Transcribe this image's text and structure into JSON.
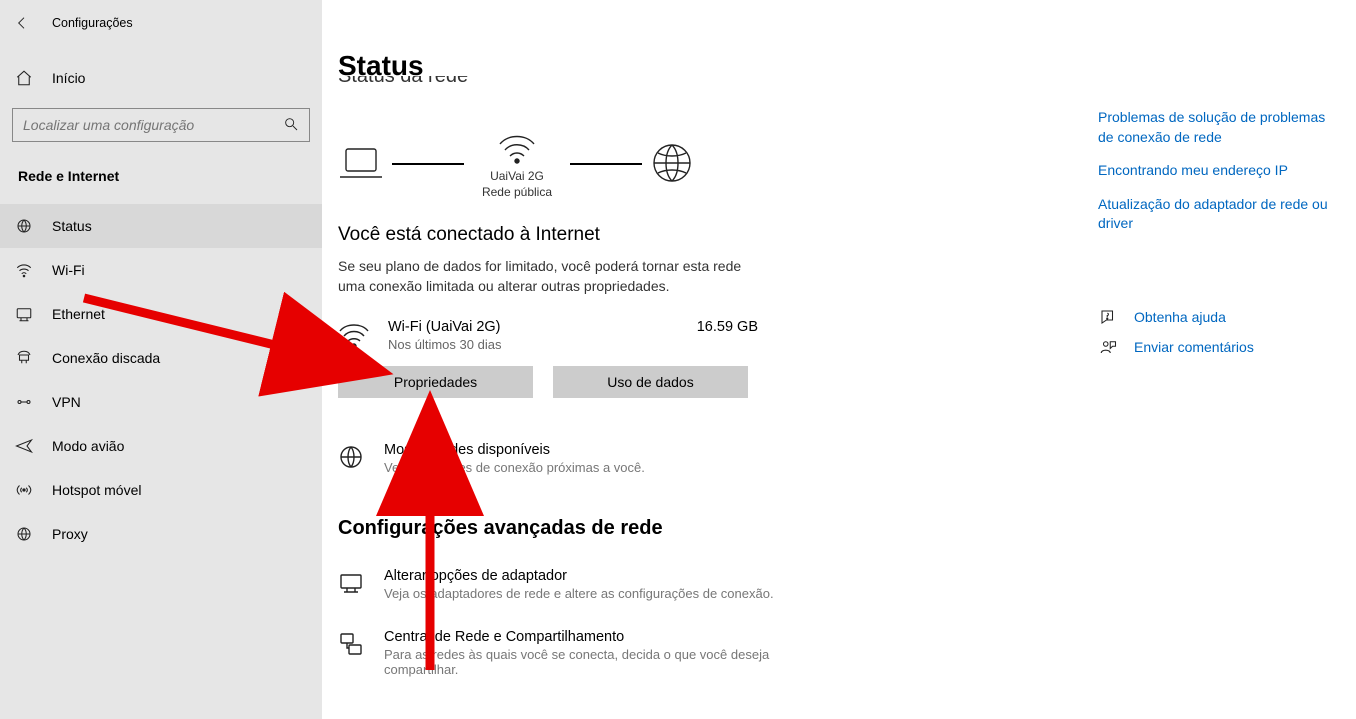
{
  "app_title": "Configurações",
  "home_label": "Início",
  "search_placeholder": "Localizar uma configuração",
  "section_label": "Rede e Internet",
  "nav": {
    "status": "Status",
    "wifi": "Wi-Fi",
    "ethernet": "Ethernet",
    "dialup": "Conexão discada",
    "vpn": "VPN",
    "airplane": "Modo avião",
    "hotspot": "Hotspot móvel",
    "proxy": "Proxy"
  },
  "page": {
    "title": "Status",
    "cutoff_heading": "Status da rede",
    "diagram_net_name": "UaiVai 2G",
    "diagram_net_type": "Rede pública",
    "connected_heading": "Você está conectado à Internet",
    "connected_desc": "Se seu plano de dados for limitado, você poderá tornar esta rede uma conexão limitada ou alterar outras propriedades.",
    "net_name": "Wi-Fi (UaiVai 2G)",
    "net_time": "Nos últimos 30 dias",
    "net_usage": "16.59 GB",
    "btn_properties": "Propriedades",
    "btn_data_usage": "Uso de dados",
    "show_networks_title": "Mostrar redes disponíveis",
    "show_networks_desc": "Veja as opções de conexão próximas a você.",
    "advanced_heading": "Configurações avançadas de rede",
    "adapter_title": "Alterar opções de adaptador",
    "adapter_desc": "Veja os adaptadores de rede e altere as configurações de conexão.",
    "sharing_title": "Central de Rede e Compartilhamento",
    "sharing_desc": "Para as redes às quais você se conecta, decida o que você deseja compartilhar."
  },
  "right": {
    "link1": "Problemas de solução de problemas de conexão de rede",
    "link2": "Encontrando meu endereço IP",
    "link3": "Atualização do adaptador de rede ou driver",
    "help": "Obtenha ajuda",
    "feedback": "Enviar comentários"
  }
}
